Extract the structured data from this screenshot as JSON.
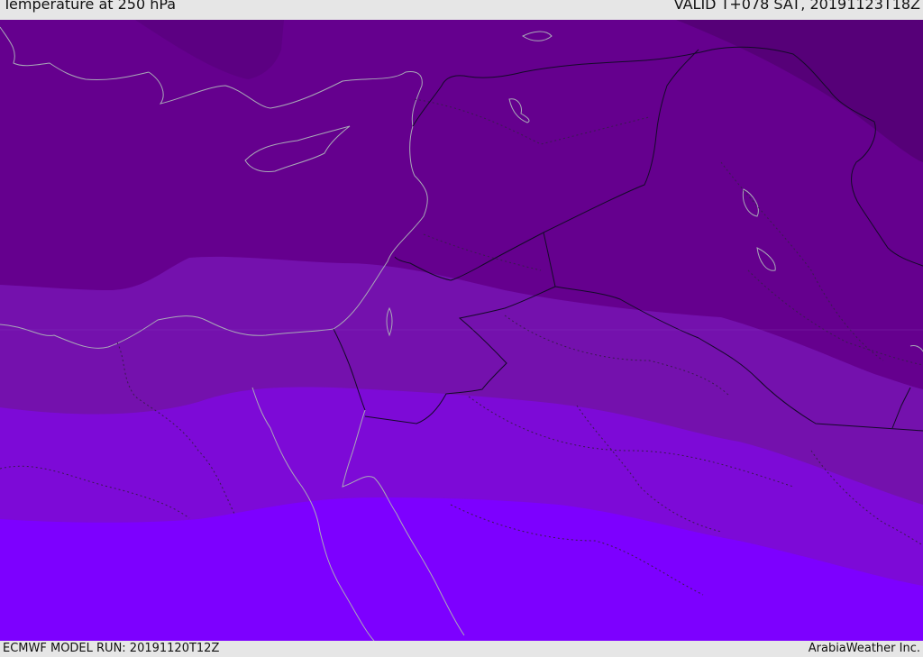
{
  "header": {
    "title": "Temperature at 250 hPa",
    "valid": "VALID T+078 SAT, 20191123T18Z"
  },
  "footer": {
    "model_run": "ECMWF MODEL RUN: 20191120T12Z",
    "credit": "ArabiaWeather Inc."
  },
  "colors": {
    "band_darkest": "#560078",
    "band_dark": "#65008e",
    "band_mid": "#7411ad",
    "band_light": "#7d0ad7",
    "band_brightest": "#7d00ff",
    "coastline": "#a9a9b8",
    "border": "#140a28"
  }
}
